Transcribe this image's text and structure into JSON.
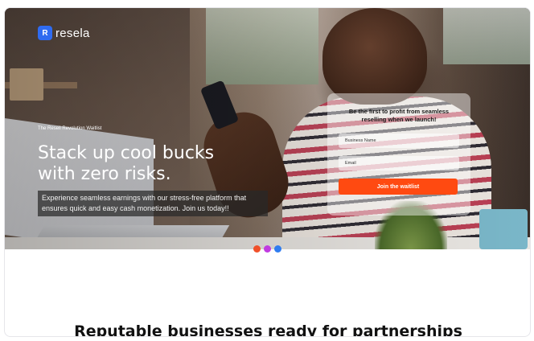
{
  "brand": {
    "logo_letter": "R",
    "name": "resela",
    "logo_color": "#2f6bf0"
  },
  "hero": {
    "eyebrow": "The Resell Revolution Waitlist",
    "headline_line1": "Stack up cool bucks",
    "headline_line2": "with zero risks.",
    "subtext": "Experience seamless earnings with our stress-free platform that ensures quick and easy cash monetization. Join us today!!"
  },
  "waitlist": {
    "title_line1": "Be the first to profit from seamless",
    "title_line2": "reselling when we launch!",
    "business_name_placeholder": "Business Name",
    "email_placeholder": "Email",
    "button_label": "Join the waitlist",
    "button_color": "#ff4a11"
  },
  "carousel": {
    "dots": [
      {
        "color": "#f0502a"
      },
      {
        "color": "#c03ae0"
      },
      {
        "color": "#2f7cf0"
      }
    ]
  },
  "partners": {
    "title": "Reputable businesses ready for partnerships"
  }
}
